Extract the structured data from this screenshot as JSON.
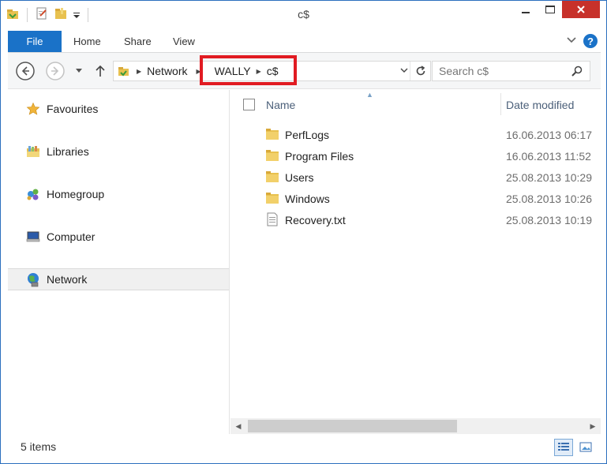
{
  "window": {
    "title": "c$"
  },
  "ribbon": {
    "tabs": [
      "File",
      "Home",
      "Share",
      "View"
    ],
    "help_glyph": "?"
  },
  "address": {
    "crumbs": [
      "Network",
      "WALLY",
      "c$"
    ]
  },
  "search": {
    "placeholder": "Search c$"
  },
  "nav_pane": {
    "items": [
      {
        "label": "Favourites",
        "icon": "star-icon"
      },
      {
        "label": "Libraries",
        "icon": "libraries-icon"
      },
      {
        "label": "Homegroup",
        "icon": "homegroup-icon"
      },
      {
        "label": "Computer",
        "icon": "computer-icon"
      },
      {
        "label": "Network",
        "icon": "network-icon",
        "selected": true
      }
    ]
  },
  "columns": {
    "name": "Name",
    "date": "Date modified"
  },
  "files": [
    {
      "name": "PerfLogs",
      "date": "16.06.2013 06:17",
      "type": "folder"
    },
    {
      "name": "Program Files",
      "date": "16.06.2013 11:52",
      "type": "folder"
    },
    {
      "name": "Users",
      "date": "25.08.2013 10:29",
      "type": "folder"
    },
    {
      "name": "Windows",
      "date": "25.08.2013 10:26",
      "type": "folder"
    },
    {
      "name": "Recovery.txt",
      "date": "25.08.2013 10:19",
      "type": "text"
    }
  ],
  "status": {
    "count": "5 items"
  },
  "colors": {
    "accent": "#1a72c8",
    "close": "#c7312a",
    "highlight_box": "#e11b22",
    "folder": "#e8c14f"
  }
}
